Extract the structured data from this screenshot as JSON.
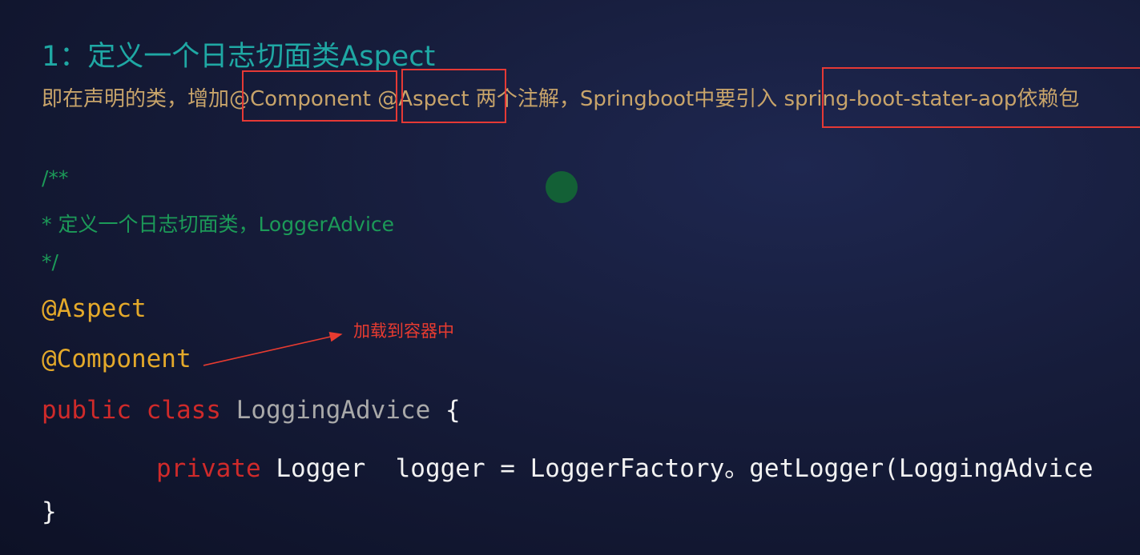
{
  "heading": "1：定义一个日志切面类Aspect",
  "description": {
    "part1": "即在声明的类，增加",
    "component": "@Component",
    "aspect": "@Aspect",
    "part2": " 两个注解，Springboot中要引入 ",
    "dependency": "spring-boot-stater-aop依赖包"
  },
  "comment": {
    "open": "/**",
    "body": "* 定义一个日志切面类，LoggerAdvice",
    "close": "*/"
  },
  "code": {
    "annotation_aspect": "@Aspect",
    "annotation_component": "@Component",
    "kw_public": "public",
    "kw_class": "class",
    "class_name": "LoggingAdvice",
    "open_brace": "{",
    "kw_private": "private",
    "logger_type": "Logger",
    "logger_stmt": "logger = LoggerFactory。getLogger(LoggingAdvice",
    "close_brace": "}"
  },
  "annotation_note": "加载到容器中",
  "colors": {
    "heading": "#1fa8a4",
    "description": "#c8a46a",
    "highlight_box": "#e53935",
    "comment": "#1c9a58",
    "annotation": "#e4a92a",
    "keyword": "#cf2a2a",
    "note": "#e83b30"
  }
}
